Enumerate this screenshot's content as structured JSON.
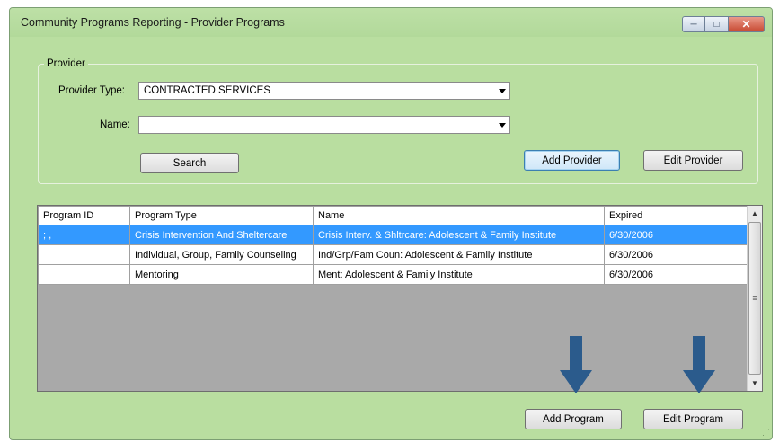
{
  "window": {
    "title": "Community Programs Reporting - Provider Programs",
    "minimize_icon": "minimize-icon",
    "maximize_icon": "maximize-icon",
    "close_icon": "close-icon",
    "colors": {
      "background": "#b9dea0",
      "selection": "#3399ff",
      "annotation_arrow": "#2b5b8c"
    }
  },
  "provider": {
    "group_label": "Provider",
    "type_label": "Provider Type:",
    "type_value": "CONTRACTED SERVICES",
    "name_label": "Name:",
    "name_value": "",
    "search_label": "Search",
    "add_provider_label": "Add Provider",
    "edit_provider_label": "Edit Provider"
  },
  "grid": {
    "columns": [
      "Program ID",
      "Program Type",
      "Name",
      "Expired"
    ],
    "rows": [
      {
        "id": "; ,",
        "type": "Crisis Intervention And Sheltercare",
        "name": "Crisis Interv. & Shltrcare:  Adolescent & Family Institute",
        "expired": "6/30/2006",
        "selected": true
      },
      {
        "id": "",
        "type": "Individual, Group, Family Counseling",
        "name": "Ind/Grp/Fam Coun:  Adolescent & Family Institute",
        "expired": "6/30/2006",
        "selected": false
      },
      {
        "id": "",
        "type": "Mentoring",
        "name": "Ment:  Adolescent & Family Institute",
        "expired": "6/30/2006",
        "selected": false
      }
    ]
  },
  "footer": {
    "add_program_label": "Add Program",
    "edit_program_label": "Edit Program"
  }
}
